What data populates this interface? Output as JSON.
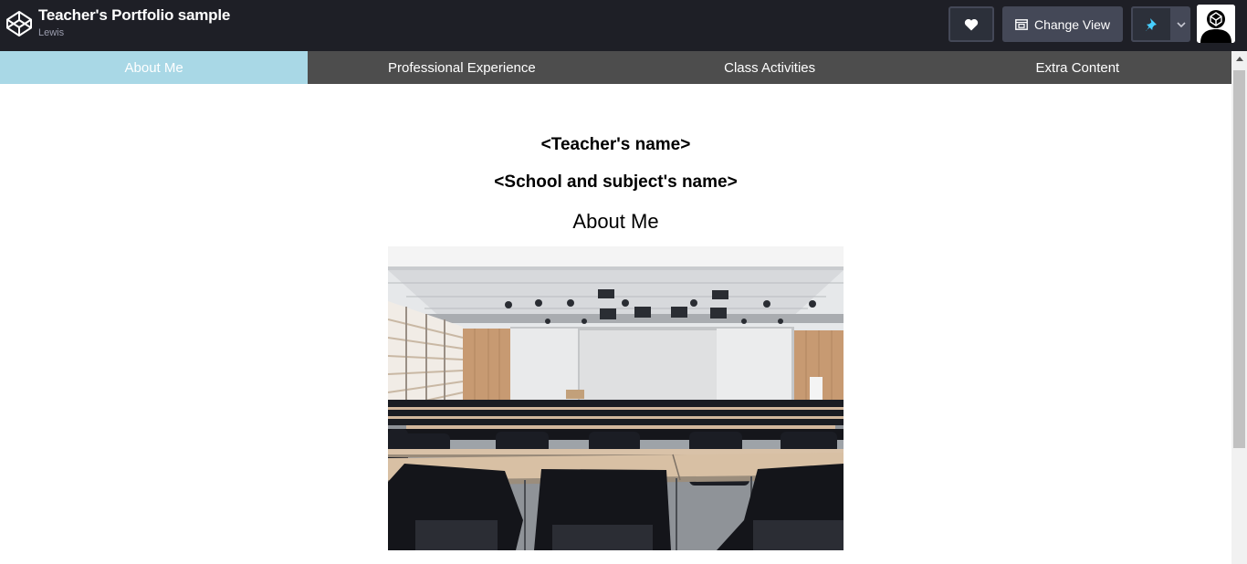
{
  "header": {
    "pen_title": "Teacher's Portfolio sample",
    "author": "Lewis",
    "change_view_label": "Change View",
    "icons": {
      "logo": "codepen-logo-icon",
      "like": "heart-icon",
      "change_view": "layout-icon",
      "pin": "pin-icon",
      "menu": "chevron-down-icon",
      "avatar": "user-avatar"
    },
    "pin_color": "#47cf73"
  },
  "nav": {
    "items": [
      {
        "label": "About Me",
        "active": true
      },
      {
        "label": "Professional Experience",
        "active": false
      },
      {
        "label": "Class Activities",
        "active": false
      },
      {
        "label": "Extra Content",
        "active": false
      }
    ],
    "active_color": "#a9d8e6",
    "background_color": "#4d4d4d"
  },
  "content": {
    "teacher_name": "<Teacher's name>",
    "school_name": "<School and subject's name>",
    "section_heading": "About Me",
    "image_subject": "empty lecture hall with rows of black chairs and desks"
  }
}
